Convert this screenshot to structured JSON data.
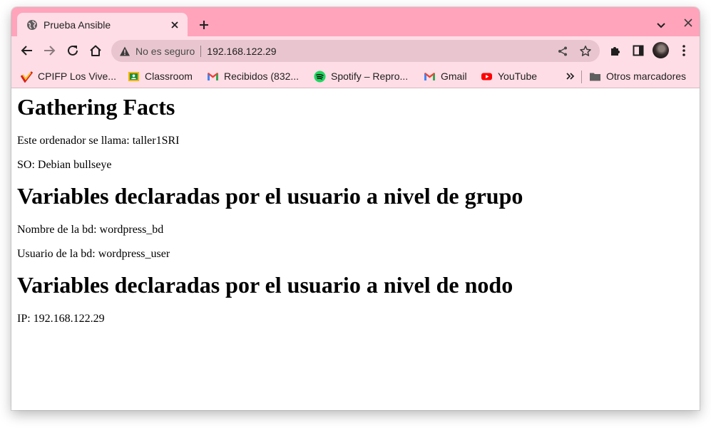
{
  "browser": {
    "tab_title": "Prueba Ansible",
    "security_label": "No es seguro",
    "url": "192.168.122.29"
  },
  "bookmarks": [
    {
      "label": "CPIFP Los Vive...",
      "icon": "cpifp-logo-icon"
    },
    {
      "label": "Classroom",
      "icon": "classroom-icon"
    },
    {
      "label": "Recibidos (832...",
      "icon": "gmail-icon"
    },
    {
      "label": "Spotify – Repro...",
      "icon": "spotify-icon"
    },
    {
      "label": "Gmail",
      "icon": "gmail-icon"
    },
    {
      "label": "YouTube",
      "icon": "youtube-icon"
    }
  ],
  "other_bookmarks": "Otros marcadores",
  "page": {
    "heading_facts": "Gathering Facts",
    "hostname_line": "Este ordenador se llama: taller1SRI",
    "os_line": "SO: Debian bullseye",
    "heading_group": "Variables declaradas por el usuario a nivel de grupo",
    "db_name_line": "Nombre de la bd: wordpress_bd",
    "db_user_line": "Usuario de la bd: wordpress_user",
    "heading_node": "Variables declaradas por el usuario a nivel de nodo",
    "ip_line": "IP: 192.168.122.29"
  },
  "colors": {
    "tabstrip": "#ffa4bb",
    "toolbar": "#ffdde6",
    "omnibox": "#e9c6cf"
  }
}
